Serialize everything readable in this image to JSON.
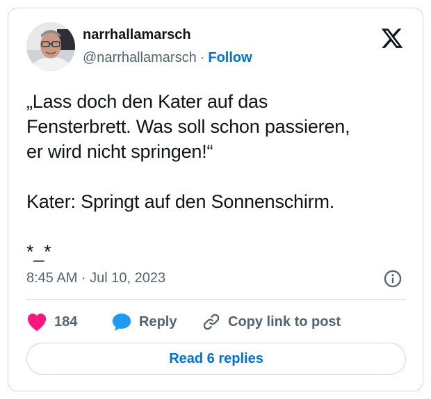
{
  "author": {
    "name": "narrhallamarsch",
    "handle": "@narrhallamarsch",
    "separator": "·",
    "follow_label": "Follow"
  },
  "post": {
    "text": "„Lass doch den Kater auf das\nFensterbrett. Was soll schon passieren,\ner wird nicht springen!“\n\nKater: Springt auf den Sonnenschirm.\n\n*_*",
    "timestamp": "8:45 AM · Jul 10, 2023"
  },
  "actions": {
    "like_count": "184",
    "reply_label": "Reply",
    "copy_label": "Copy link to post"
  },
  "footer": {
    "read_replies_label": "Read 6 replies"
  },
  "icons": {
    "logo": "x-logo-icon",
    "info": "info-icon",
    "like": "heart-icon",
    "reply": "speech-bubble-icon",
    "copy": "link-icon"
  },
  "colors": {
    "accent": "#006fd6",
    "heart": "#f91880",
    "reply_bubble": "#1d9bf0",
    "text": "#0f1419",
    "muted": "#536471",
    "border": "#cfd9de"
  }
}
